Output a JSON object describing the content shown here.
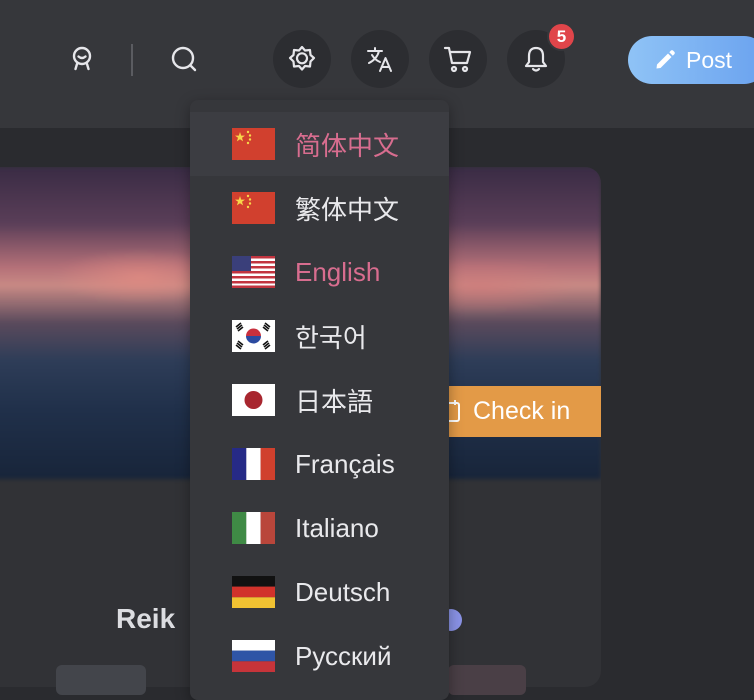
{
  "header": {
    "notification_count": "5",
    "post_label": "Post",
    "icons": [
      "user-icon",
      "search-icon",
      "theme-icon",
      "translate-icon",
      "cart-icon",
      "bell-icon",
      "pencil-icon"
    ]
  },
  "content": {
    "checkin_label": "Check in",
    "username_partial": "Reik"
  },
  "languages": [
    {
      "label": "简体中文",
      "flag": "china",
      "active": true
    },
    {
      "label": "繁体中文",
      "flag": "china",
      "active": false
    },
    {
      "label": "English",
      "flag": "usa",
      "active": true
    },
    {
      "label": "한국어",
      "flag": "korea",
      "active": false
    },
    {
      "label": "日本語",
      "flag": "japan",
      "active": false
    },
    {
      "label": "Français",
      "flag": "france",
      "active": false
    },
    {
      "label": "Italiano",
      "flag": "italy",
      "active": false
    },
    {
      "label": "Deutsch",
      "flag": "germany",
      "active": false
    },
    {
      "label": "Русский",
      "flag": "russia",
      "active": false
    }
  ],
  "colors": {
    "header_bg": "#36373b",
    "page_bg": "#2a2b2f",
    "active_lang": "#d86d8f",
    "checkin": "#e39a47",
    "badge": "#e0454a",
    "post_gradient_start": "#8fc3f6",
    "post_gradient_end": "#6aa2ef"
  }
}
